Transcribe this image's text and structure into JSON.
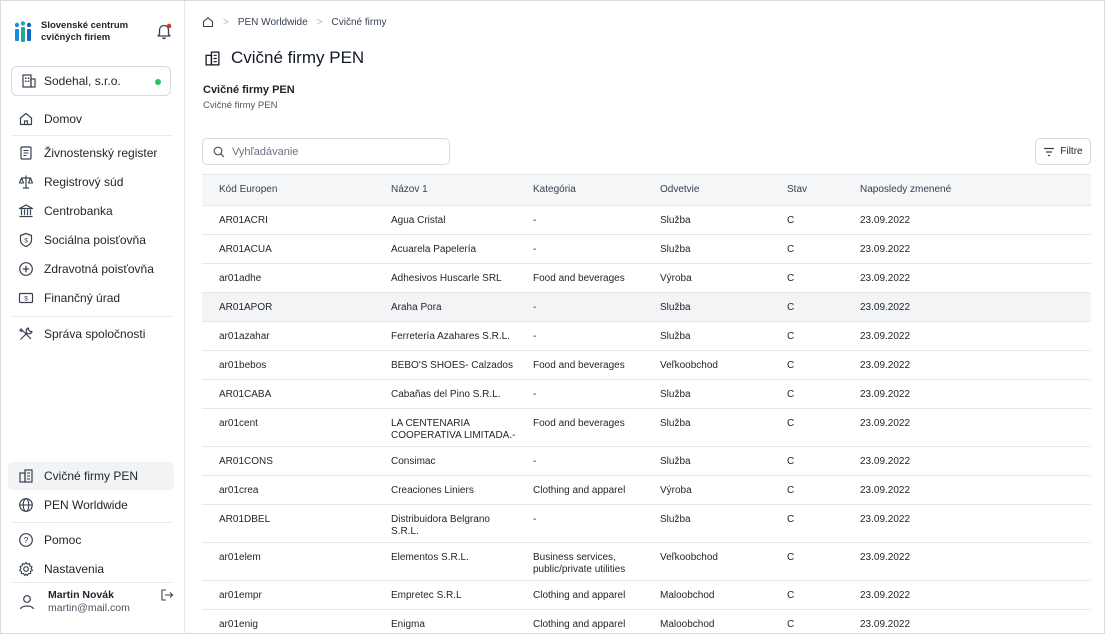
{
  "brand": {
    "name": "Slovenské centrum cvičných firiem"
  },
  "company": {
    "name": "Sodehal, s.r.o."
  },
  "nav": {
    "home": "Domov",
    "items": [
      "Živnostenský register",
      "Registrový súd",
      "Centrobanka",
      "Sociálna poisťovňa",
      "Zdravotná poisťovňa",
      "Finančný úrad"
    ],
    "manage": "Správa spoločnosti",
    "bottom": [
      "Cvičné firmy PEN",
      "PEN Worldwide"
    ],
    "help": "Pomoc",
    "settings": "Nastavenia"
  },
  "user": {
    "name": "Martin Novák",
    "email": "martin@mail.com"
  },
  "breadcrumb": {
    "items": [
      "PEN Worldwide",
      "Cvičné firmy"
    ]
  },
  "page": {
    "title": "Cvičné firmy PEN",
    "section_title": "Cvičné firmy PEN",
    "section_subtitle": "Cvičné firmy PEN"
  },
  "search": {
    "placeholder": "Vyhľadávanie"
  },
  "filter": {
    "label": "Filtre"
  },
  "table": {
    "columns": [
      "Kód Europen",
      "Názov 1",
      "Kategória",
      "Odvetvie",
      "Stav",
      "Naposledy zmenené"
    ],
    "rows": [
      [
        "AR01ACRI",
        "Agua Cristal",
        "-",
        "Služba",
        "C",
        "23.09.2022"
      ],
      [
        "AR01ACUA",
        "Acuarela Papelería",
        "-",
        "Služba",
        "C",
        "23.09.2022"
      ],
      [
        "ar01adhe",
        "Adhesivos Huscarle SRL",
        "Food and beverages",
        "Výroba",
        "C",
        "23.09.2022"
      ],
      [
        "AR01APOR",
        "Araha Pora",
        "-",
        "Služba",
        "C",
        "23.09.2022"
      ],
      [
        "ar01azahar",
        "Ferretería Azahares S.R.L.",
        "-",
        "Služba",
        "C",
        "23.09.2022"
      ],
      [
        "ar01bebos",
        "BEBO'S SHOES- Calzados",
        "Food and beverages",
        "Veľkoobchod",
        "C",
        "23.09.2022"
      ],
      [
        "AR01CABA",
        "Cabañas del Pino S.R.L.",
        "-",
        "Služba",
        "C",
        "23.09.2022"
      ],
      [
        "ar01cent",
        "LA CENTENARIA COOPERATIVA LIMITADA.-",
        "Food and beverages",
        "Služba",
        "C",
        "23.09.2022"
      ],
      [
        "AR01CONS",
        "Consimac",
        "-",
        "Služba",
        "C",
        "23.09.2022"
      ],
      [
        "ar01crea",
        "Creaciones Liniers",
        "Clothing and apparel",
        "Výroba",
        "C",
        "23.09.2022"
      ],
      [
        "AR01DBEL",
        "Distribuidora Belgrano S.R.L.",
        "-",
        "Služba",
        "C",
        "23.09.2022"
      ],
      [
        "ar01elem",
        "Elementos S.R.L.",
        "Business services, public/private utilities",
        "Veľkoobchod",
        "C",
        "23.09.2022"
      ],
      [
        "ar01empr",
        "Empretec S.R.L",
        "Clothing and apparel",
        "Maloobchod",
        "C",
        "23.09.2022"
      ],
      [
        "ar01enig",
        "Enigma",
        "Clothing and apparel",
        "Maloobchod",
        "C",
        "23.09.2022"
      ]
    ]
  },
  "colors": {
    "accent_green": "#22c55e",
    "notification_red": "#e03131",
    "row_highlight": "#f3f4f6",
    "header_bg": "#f5f6f7"
  }
}
